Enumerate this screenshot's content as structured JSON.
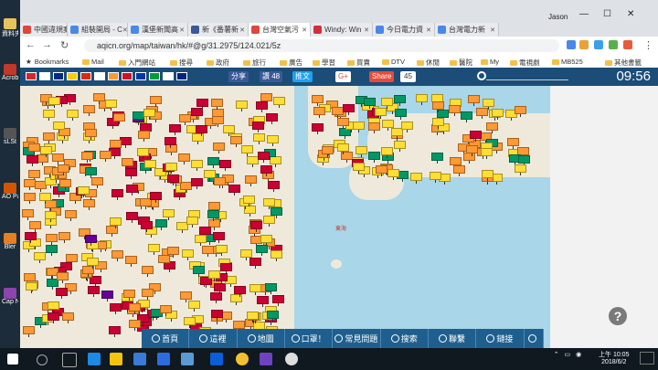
{
  "desktop": {
    "icons": [
      {
        "label": "資料夾"
      },
      {
        "label": "Acrob Reade"
      },
      {
        "label": "sLSt"
      },
      {
        "label": "AO Parti"
      },
      {
        "label": "Bler"
      },
      {
        "label": "Cap NX"
      }
    ]
  },
  "browser": {
    "tabs": [
      {
        "label": "中國違規案列",
        "color": "#e0463a"
      },
      {
        "label": "組裝開局 - C",
        "color": "#4a88e8"
      },
      {
        "label": "漢堡新聞高",
        "color": "#4a88e8"
      },
      {
        "label": "新《番薯新",
        "color": "#3b5998"
      },
      {
        "label": "台灣空氣污",
        "color": "#e0463a"
      },
      {
        "label": "Windy: Win",
        "color": "#d22f3b"
      },
      {
        "label": "今日電力資",
        "color": "#4a88e8"
      },
      {
        "label": "台灣電力新",
        "color": "#4a88e8"
      }
    ],
    "user_label": "Jason",
    "url": "aqicn.org/map/taiwan/hk/#@g/31.2975/124.021/5z",
    "bookmarks": [
      "Bookmarks",
      "Mail",
      "入門網站",
      "搜尋",
      "政府",
      "旅行",
      "廣告",
      "學習",
      "買賣",
      "DTV",
      "休閒",
      "醫院",
      "My",
      "電視劇",
      "MB525",
      "其他書籤"
    ]
  },
  "aqi_toolbar": {
    "flags": [
      "#d62828",
      "#ffffff",
      "#002b7f",
      "#ffcc00",
      "#de2910",
      "#ffffff",
      "#ff9933",
      "#ce1126",
      "#0038a8",
      "#009c3b",
      "#ffffff",
      "#00247d"
    ],
    "fb_share": "分享",
    "like_label": "讚 48",
    "tweet_label": "推文",
    "gplus_label": "G+",
    "share_label": "Share",
    "share_count": "45",
    "time": "09:56"
  },
  "map": {
    "sea_label": "東海"
  },
  "bottom_nav": [
    {
      "label": "首頁"
    },
    {
      "label": "這裡"
    },
    {
      "label": "地圖"
    },
    {
      "label": "口罩！"
    },
    {
      "label": "常見問題"
    },
    {
      "label": "搜索"
    },
    {
      "label": "聯繫"
    },
    {
      "label": "鏈接"
    },
    {
      "label": ""
    }
  ],
  "taskbar": {
    "tray_time": "上午 10:05",
    "tray_date": "2018/6/2"
  }
}
